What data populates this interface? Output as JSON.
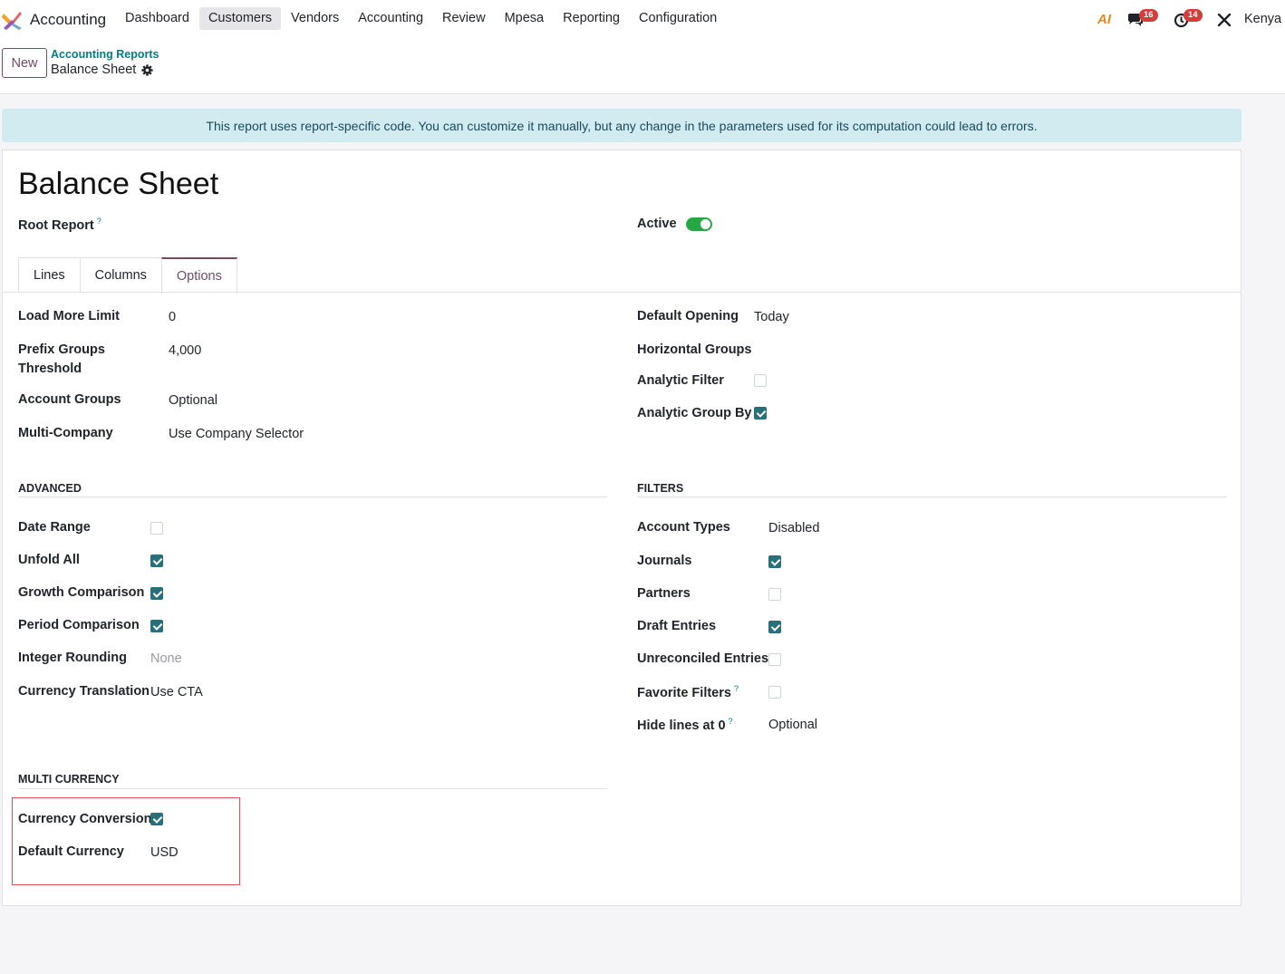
{
  "navbar": {
    "app_name": "Accounting",
    "menu": [
      "Dashboard",
      "Customers",
      "Vendors",
      "Accounting",
      "Review",
      "Mpesa",
      "Reporting",
      "Configuration"
    ],
    "active_menu": "Customers",
    "ai_label": "AI",
    "messages_count": "16",
    "activities_count": "14",
    "company": "Kenya I"
  },
  "control_panel": {
    "new_label": "New",
    "breadcrumb_parent": "Accounting Reports",
    "breadcrumb_current": "Balance Sheet"
  },
  "alert": {
    "text": "This report uses report-specific code. You can customize it manually, but any change in the parameters used for its computation could lead to errors."
  },
  "form": {
    "title": "Balance Sheet",
    "root_report_label": "Root Report",
    "help_mark": "?",
    "active_label": "Active",
    "active_value": true,
    "tabs": [
      "Lines",
      "Columns",
      "Options"
    ],
    "active_tab": "Options",
    "left_fields": {
      "load_more_limit": {
        "label": "Load More Limit",
        "value": "0"
      },
      "prefix_groups_threshold": {
        "label_line1": "Prefix Groups",
        "label_line2": "Threshold",
        "value": "4,000"
      },
      "account_groups": {
        "label": "Account Groups",
        "value": "Optional"
      },
      "multi_company": {
        "label": "Multi-Company",
        "value": "Use Company Selector"
      }
    },
    "right_fields": {
      "default_opening": {
        "label": "Default Opening",
        "value": "Today"
      },
      "horizontal_groups": {
        "label": "Horizontal Groups",
        "value": ""
      },
      "analytic_filter": {
        "label": "Analytic Filter",
        "checked": false
      },
      "analytic_group_by": {
        "label": "Analytic Group By",
        "checked": true
      }
    },
    "advanced": {
      "title": "ADVANCED",
      "date_range": {
        "label": "Date Range",
        "checked": false
      },
      "unfold_all": {
        "label": "Unfold All",
        "checked": true
      },
      "growth_comparison": {
        "label": "Growth Comparison",
        "checked": true
      },
      "period_comparison": {
        "label": "Period Comparison",
        "checked": true
      },
      "integer_rounding": {
        "label": "Integer Rounding",
        "value": "None"
      },
      "currency_translation": {
        "label": "Currency Translation",
        "value": "Use CTA"
      }
    },
    "filters": {
      "title": "FILTERS",
      "account_types": {
        "label": "Account Types",
        "value": "Disabled"
      },
      "journals": {
        "label": "Journals",
        "checked": true
      },
      "partners": {
        "label": "Partners",
        "checked": false
      },
      "draft_entries": {
        "label": "Draft Entries",
        "checked": true
      },
      "unreconciled_entries": {
        "label": "Unreconciled Entries",
        "checked": false
      },
      "favorite_filters": {
        "label": "Favorite Filters",
        "checked": false
      },
      "hide_lines_at_0": {
        "label": "Hide lines at 0",
        "value": "Optional"
      }
    },
    "multi_currency": {
      "title": "MULTI CURRENCY",
      "currency_conversion": {
        "label": "Currency Conversion",
        "checked": true
      },
      "default_currency": {
        "label": "Default Currency",
        "value": "USD"
      }
    }
  },
  "colors": {
    "brand": "#714b67",
    "link": "#017e84",
    "checkbox": "#28707a",
    "toggle_on": "#28a745",
    "alert_bg": "#d1ebf0",
    "highlight": "#e0505a",
    "badge": "#d23f3a"
  },
  "icons": [
    "app-logo-icon",
    "chat-icon",
    "clock-icon",
    "tools-icon",
    "gear-icon"
  ]
}
